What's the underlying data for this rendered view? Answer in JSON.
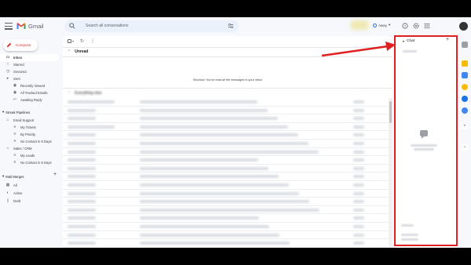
{
  "app": {
    "name": "Gmail"
  },
  "search": {
    "placeholder": "Search all conversations"
  },
  "header": {
    "status_label": "Away"
  },
  "compose": {
    "label": "Compose"
  },
  "nav": {
    "items": [
      {
        "label": "Inbox",
        "icon": "inbox-icon"
      },
      {
        "label": "Starred",
        "icon": "star-icon"
      },
      {
        "label": "Snoozed",
        "icon": "clock-icon"
      },
      {
        "label": "Sent",
        "icon": "send-icon"
      }
    ],
    "sent_subitems": [
      {
        "label": "Recently Viewed",
        "icon": "eye-icon"
      },
      {
        "label": "All Tracked Emails",
        "icon": "eye-icon"
      },
      {
        "label": "Awaiting Reply",
        "icon": "reply-icon"
      }
    ],
    "streak_title": "Streak Pipelines",
    "email_support": {
      "label": "Email Support",
      "children": [
        "My Tickets",
        "By Priority",
        "No Contact in 5 Days"
      ]
    },
    "sales_crm": {
      "label": "Sales / CRM",
      "children": [
        "My Leads",
        "No Contact in 5 Days"
      ]
    },
    "mail_merges_title": "Mail Merges",
    "mail_merges": [
      "All",
      "Active",
      "Draft"
    ]
  },
  "main": {
    "section_unread": "Unread",
    "empty_message": "Woohoo! You've read all the messages in your inbox",
    "section_everything": "Everything else"
  },
  "chat": {
    "title": "Chat"
  },
  "colors": {
    "annotation": "#e02020",
    "accent": "#d93025",
    "brand_blue": "#1a73e8"
  }
}
